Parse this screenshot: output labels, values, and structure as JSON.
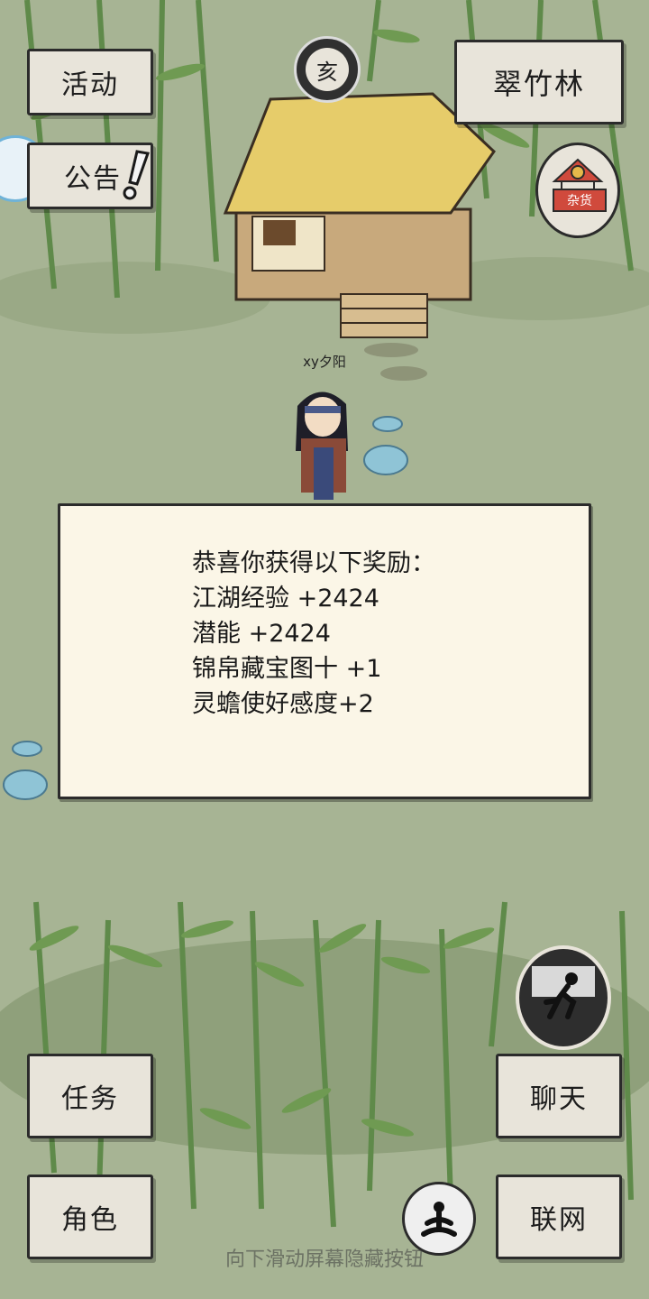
{
  "top_left": {
    "activity_label": "活动",
    "notice_label": "公告"
  },
  "location": {
    "name": "翠竹林"
  },
  "time_badge": {
    "glyph": "亥"
  },
  "shop_badge": {
    "sign": "杂货"
  },
  "player": {
    "name": "xy夕阳"
  },
  "reward_dialog": {
    "lines": [
      "恭喜你获得以下奖励：",
      "江湖经验 +2424",
      "潜能 +2424",
      "锦帛藏宝图十 +1",
      "灵蟾使好感度+2"
    ]
  },
  "bottom_left": {
    "task_label": "任务",
    "role_label": "角色"
  },
  "bottom_right": {
    "chat_label": "聊天",
    "network_label": "联网"
  },
  "hint": "向下滑动屏幕隐藏按钮",
  "colors": {
    "background": "#a7b494",
    "button_bg": "#e8e4da",
    "dialog_bg": "#fbf6e7",
    "shop_red": "#d04a3c"
  }
}
